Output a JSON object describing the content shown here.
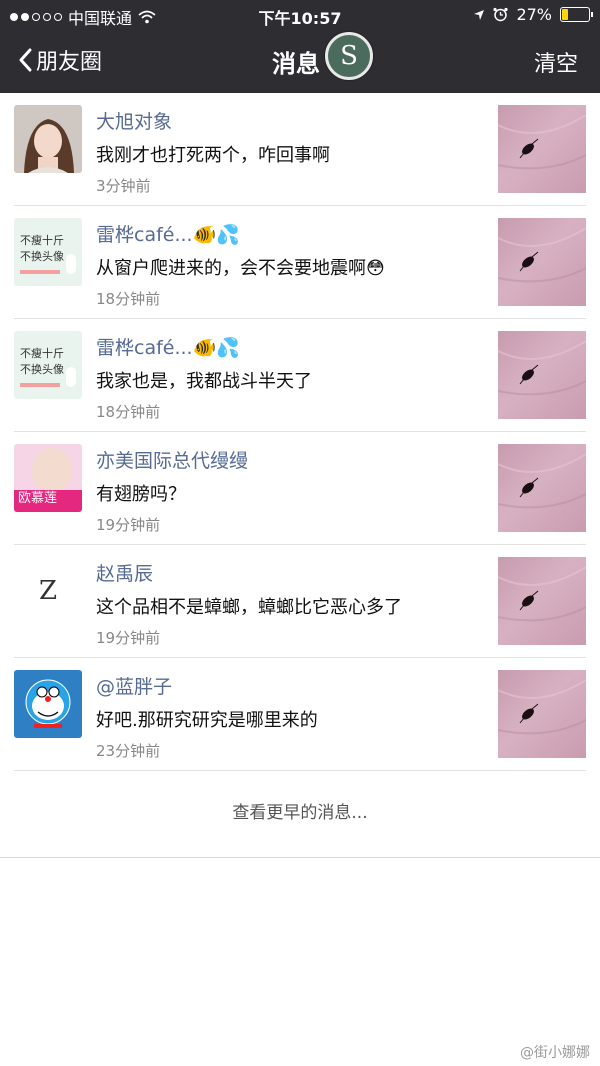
{
  "status": {
    "carrier": "中国联通",
    "time": "下午10:57",
    "battery": "27%",
    "battery_level": 0.27,
    "battery_color": "#ffd60a"
  },
  "nav": {
    "back_label": "朋友圈",
    "title": "消息",
    "logo_letter": "S",
    "clear_label": "清空"
  },
  "messages": [
    {
      "name": "大旭对象",
      "text": "我刚才也打死两个，咋回事啊",
      "time": "3分钟前",
      "avatar": "photo-female"
    },
    {
      "name": "雷桦café...🐠💦",
      "text": "从窗户爬进来的，会不会要地震啊😳",
      "time": "18分钟前",
      "avatar": "text-card",
      "avatar_text": [
        "不瘦十斤",
        "不换头像"
      ]
    },
    {
      "name": "雷桦café...🐠💦",
      "text": "我家也是，我都战斗半天了",
      "time": "18分钟前",
      "avatar": "text-card",
      "avatar_text": [
        "不瘦十斤",
        "不换头像"
      ]
    },
    {
      "name": "亦美国际总代缦缦",
      "text": "有翅膀吗？",
      "time": "19分钟前",
      "avatar": "brand",
      "avatar_text": [
        "欧慕莲"
      ]
    },
    {
      "name": "赵禹辰",
      "text": "这个品相不是蟑螂，蟑螂比它恶心多了",
      "time": "19分钟前",
      "avatar": "letter",
      "avatar_text": [
        "Z"
      ]
    },
    {
      "name": "@蓝胖子",
      "text": "好吧.那研究研究是哪里来的",
      "time": "23分钟前",
      "avatar": "cartoon"
    }
  ],
  "more_label": "查看更早的消息...",
  "watermark": "@街小娜娜",
  "colors": {
    "bar": "#2e2e32",
    "name": "#576b95"
  }
}
